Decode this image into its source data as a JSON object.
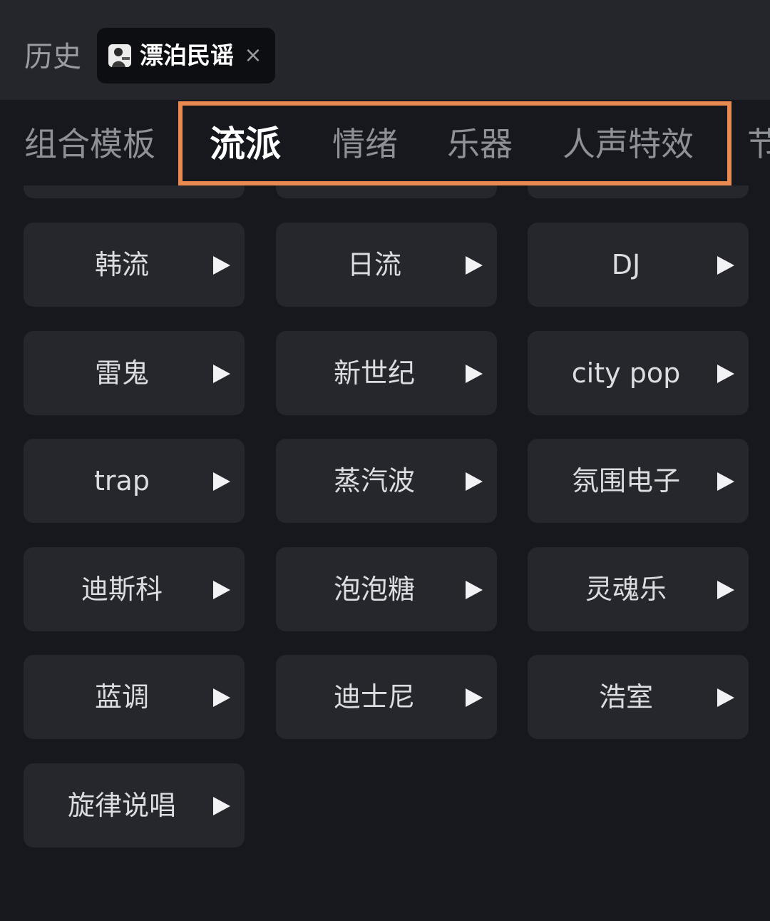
{
  "history": {
    "label": "历史",
    "chip": {
      "label": "漂泊民谣",
      "close": "×"
    }
  },
  "tabs": [
    {
      "label": "组合模板",
      "active": false
    },
    {
      "label": "流派",
      "active": true
    },
    {
      "label": "情绪",
      "active": false
    },
    {
      "label": "乐器",
      "active": false
    },
    {
      "label": "人声特效",
      "active": false
    },
    {
      "label": "节",
      "active": false
    }
  ],
  "colors": {
    "highlight": "#e98a50",
    "background": "#17181d",
    "card": "#25272c"
  },
  "genres": [
    {
      "label": "韩流",
      "icon": "play-icon"
    },
    {
      "label": "日流",
      "icon": "play-icon"
    },
    {
      "label": "DJ",
      "icon": "play-icon"
    },
    {
      "label": "雷鬼",
      "icon": "play-icon"
    },
    {
      "label": "新世纪",
      "icon": "play-icon"
    },
    {
      "label": "city pop",
      "icon": "play-icon"
    },
    {
      "label": "trap",
      "icon": "play-icon"
    },
    {
      "label": "蒸汽波",
      "icon": "play-icon"
    },
    {
      "label": "氛围电子",
      "icon": "play-icon"
    },
    {
      "label": "迪斯科",
      "icon": "play-icon"
    },
    {
      "label": "泡泡糖",
      "icon": "play-icon"
    },
    {
      "label": "灵魂乐",
      "icon": "play-icon"
    },
    {
      "label": "蓝调",
      "icon": "play-icon"
    },
    {
      "label": "迪士尼",
      "icon": "play-icon"
    },
    {
      "label": "浩室",
      "icon": "play-icon"
    },
    {
      "label": "旋律说唱",
      "icon": "play-icon"
    }
  ]
}
